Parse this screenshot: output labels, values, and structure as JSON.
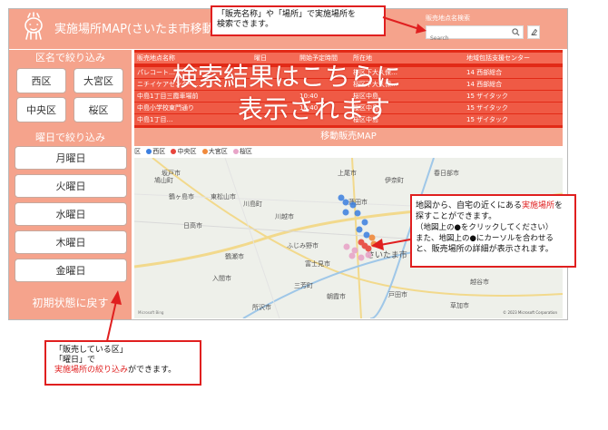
{
  "header": {
    "app_title": "実施場所MAP(さいたま市移動販売",
    "search_label": "販売地点名検索",
    "search_placeholder": "Search"
  },
  "filters": {
    "ward_heading": "区名で絞り込み",
    "wards": [
      "西区",
      "大宮区",
      "中央区",
      "桜区"
    ],
    "day_heading": "曜日で絞り込み",
    "days": [
      "月曜日",
      "火曜日",
      "水曜日",
      "木曜日",
      "金曜日"
    ],
    "reset_label": "初期状態に戻す"
  },
  "results": {
    "columns": [
      "販売地点名称",
      "曜日",
      "開始予定時間",
      "所在地",
      "地域包括支援センター"
    ],
    "rows": [
      [
        "パレコート…",
        "",
        "",
        "桜区下大久保…",
        "14 西部総合"
      ],
      [
        "ニチイケアセンター…",
        "",
        "",
        "桜区下大久保…",
        "14 西部総合"
      ],
      [
        "中島1丁目三霞車場前",
        "",
        "10:40",
        "桜区中島",
        "15 ザイタック"
      ],
      [
        "中島小学校東門通り",
        "",
        "10:40",
        "桜区中島",
        "15 ザイタック"
      ],
      [
        "中島1丁目…",
        "",
        "",
        "桜区中島",
        "15 ザイタック"
      ]
    ],
    "overlay_line1": "検索結果はこちらに",
    "overlay_line2": "表示されます"
  },
  "map": {
    "title": "移動販売MAP",
    "legend_prefix": "区",
    "legend": [
      {
        "name": "西区",
        "color": "#3b7fe0"
      },
      {
        "name": "中央区",
        "color": "#e8453c"
      },
      {
        "name": "大宮区",
        "color": "#f08a3c"
      },
      {
        "name": "桜区",
        "color": "#e8a5c8"
      }
    ],
    "labels": [
      "坂戸市",
      "鶴ヶ島市",
      "川越市",
      "上尾市",
      "伊奈町",
      "春日部市",
      "東松山市",
      "川島町",
      "蓮田市",
      "日高市",
      "ふじみ野市",
      "富士見市",
      "さいたま市",
      "鶴瀬市",
      "入間市",
      "三芳町",
      "朝霞市",
      "戸田市",
      "所沢市",
      "越谷市",
      "草加市",
      "鳩山町"
    ],
    "copyright": "© 2023 Microsoft Corporation",
    "brand": "Microsoft Bing"
  },
  "callouts": {
    "top_line1": "「販売名称」や「場所」で実施場所を",
    "top_line2": "検索できます。",
    "right_line1_a": "地図から、自宅の近くにある",
    "right_line1_b": "実施場所",
    "right_line1_c": "を",
    "right_line2": "探すことができます。",
    "right_line3": "（地図上の●をクリックしてください）",
    "right_line4": "また、地図上の●にカーソルを合わせる",
    "right_line5": "と、販売場所の詳細が表示されます。",
    "bottom_line1": "「販売している区」",
    "bottom_line2": "「曜日」で",
    "bottom_line3_a": "実施場所の絞り込み",
    "bottom_line3_b": "ができます。"
  }
}
